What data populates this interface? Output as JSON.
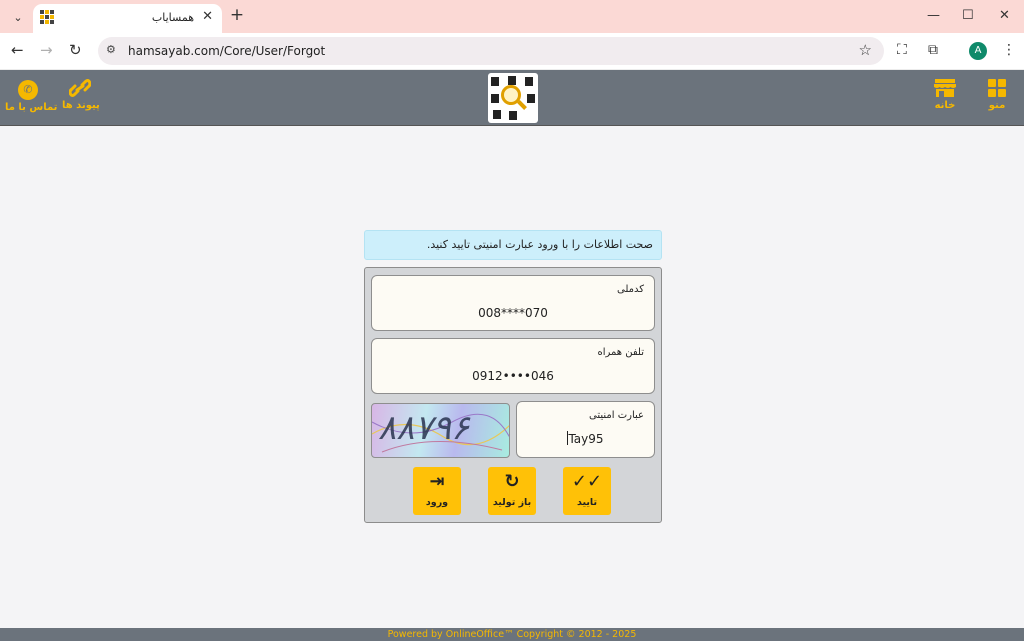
{
  "browser": {
    "tab_title": "همسایاب",
    "tab_close": "✕",
    "new_tab": "+",
    "url": "hamsayab.com/Core/User/Forgot",
    "profile_initial": "A",
    "window": {
      "minimize": "—",
      "maximize": "☐",
      "close": "✕"
    }
  },
  "header": {
    "menu_label": "منو",
    "home_label": "خانه",
    "links_label": "پیوند ها",
    "contact_label": "تماس با ما"
  },
  "form": {
    "info_message": "صحت اطلاعات را با ورود عبارت امنیتی تایید کنید.",
    "national_code": {
      "label": "کدملی",
      "value": "008****070"
    },
    "mobile": {
      "label": "تلفن همراه",
      "value": "0912••••046"
    },
    "security_phrase": {
      "label": "عبارت امنیتی",
      "value": "Tay95"
    },
    "captcha_text": "۸۸۷۹۶",
    "buttons": {
      "confirm": "تایید",
      "regenerate": "باز تولید",
      "login": "ورود"
    }
  },
  "footer": {
    "text": "Powered by OnlineOffice™ Copyright © 2012 - 2025"
  },
  "colors": {
    "accent": "#f5b800",
    "header_bg": "#6b737c",
    "button": "#ffc107",
    "info_bg": "#cdeffb"
  }
}
